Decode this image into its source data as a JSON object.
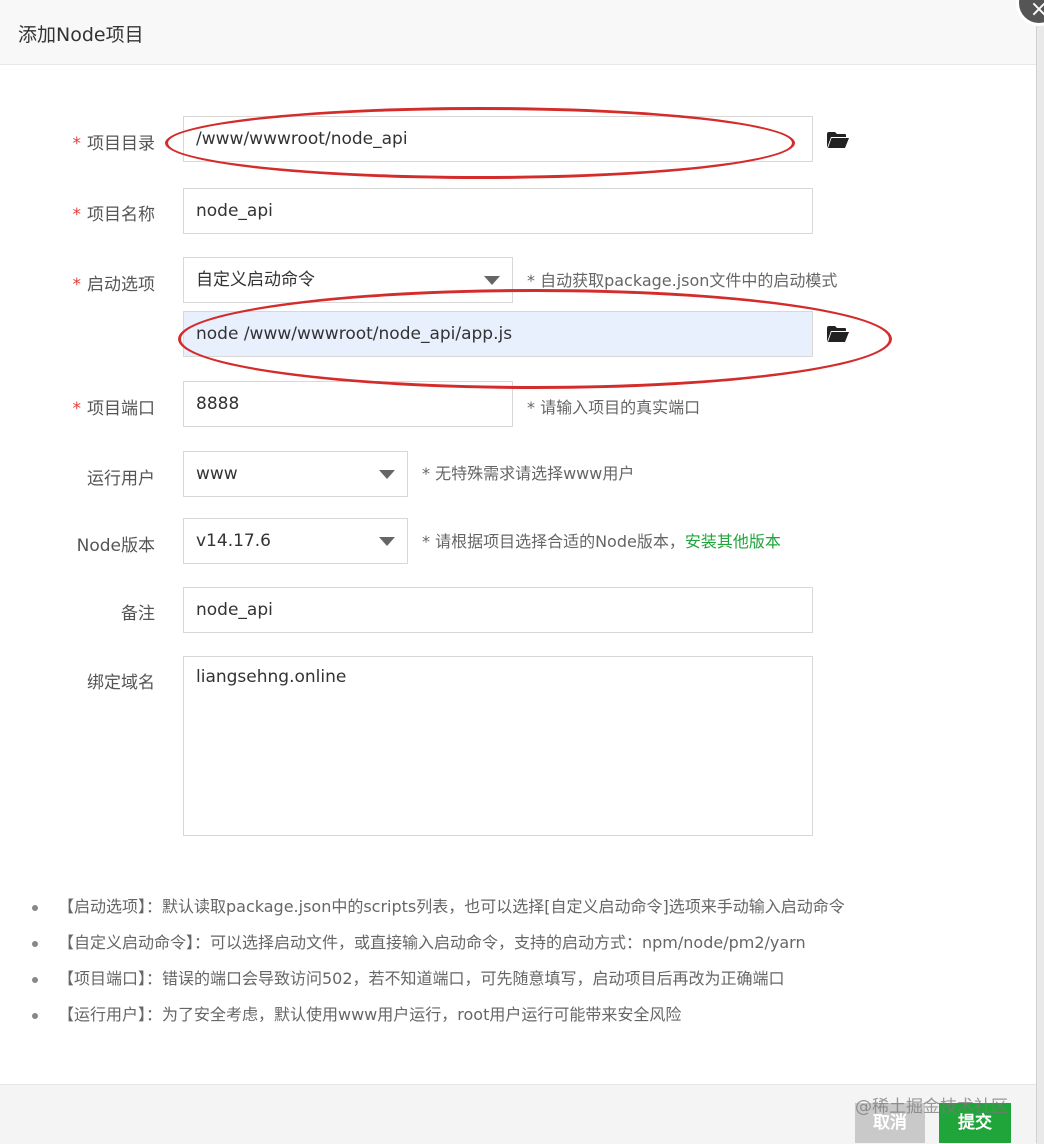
{
  "dialog": {
    "title": "添加Node项目",
    "close_icon": "×"
  },
  "form": {
    "project_dir": {
      "label": "项目目录",
      "value": "/www/wwwroot/node_api"
    },
    "project_name": {
      "label": "项目名称",
      "value": "node_api"
    },
    "start_option": {
      "label": "启动选项",
      "selected": "自定义启动命令",
      "hint": "* 自动获取package.json文件中的启动模式",
      "command_value": "node /www/wwwroot/node_api/app.js"
    },
    "port": {
      "label": "项目端口",
      "value": "8888",
      "hint": "* 请输入项目的真实端口"
    },
    "run_user": {
      "label": "运行用户",
      "selected": "www",
      "hint": "* 无特殊需求请选择www用户"
    },
    "node_version": {
      "label": "Node版本",
      "selected": "v14.17.6",
      "hint": "* 请根据项目选择合适的Node版本，",
      "link": "安装其他版本"
    },
    "remark": {
      "label": "备注",
      "value": "node_api"
    },
    "domain": {
      "label": "绑定域名",
      "value": "liangsehng.online"
    },
    "required_mark": "*"
  },
  "notes": [
    "【启动选项】：默认读取package.json中的scripts列表，也可以选择[自定义启动命令]选项来手动输入启动命令",
    "【自定义启动命令】：可以选择启动文件，或直接输入启动命令，支持的启动方式：npm/node/pm2/yarn",
    "【项目端口】：错误的端口会导致访问502，若不知道端口，可先随意填写，启动项目后再改为正确端口",
    "【运行用户】：为了安全考虑，默认使用www用户运行，root用户运行可能带来安全风险"
  ],
  "footer": {
    "cancel_label": "取消",
    "submit_label": "提交"
  },
  "watermark": "@稀土掘金技术社区",
  "colors": {
    "accent": "#20a53a",
    "required": "#e23c3c",
    "annotation": "#d42b2b"
  }
}
